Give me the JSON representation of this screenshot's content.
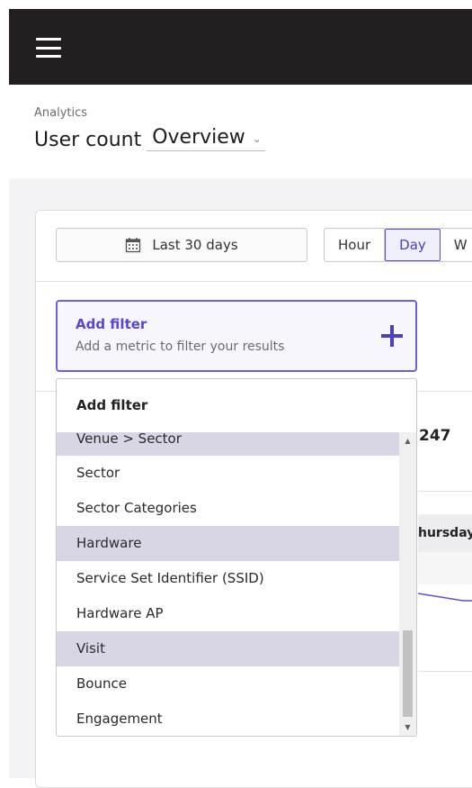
{
  "header": {
    "menu_icon": "hamburger-menu-icon"
  },
  "page": {
    "breadcrumb": "Analytics",
    "title": "User count",
    "view_selected": "Overview"
  },
  "toolbar": {
    "date_range_label": "Last 30 days",
    "granularity": [
      "Hour",
      "Day",
      "W"
    ],
    "granularity_selected": "Day"
  },
  "filter": {
    "title": "Add filter",
    "subtitle": "Add a metric to filter your results"
  },
  "background": {
    "stat_fragment": "247",
    "date_fragment": "hursday,"
  },
  "dropdown": {
    "header": "Add filter",
    "items": [
      {
        "label": "Venue > Sector",
        "highlight": true
      },
      {
        "label": "Sector",
        "highlight": false
      },
      {
        "label": "Sector Categories",
        "highlight": false
      },
      {
        "label": "Hardware",
        "highlight": true
      },
      {
        "label": "Service Set Identifier (SSID)",
        "highlight": false
      },
      {
        "label": "Hardware AP",
        "highlight": false
      },
      {
        "label": "Visit",
        "highlight": true
      },
      {
        "label": "Bounce",
        "highlight": false
      },
      {
        "label": "Engagement",
        "highlight": false
      }
    ]
  },
  "colors": {
    "accent": "#5546d6",
    "topbar": "#231f20",
    "highlight_row": "#d8d6e4"
  }
}
